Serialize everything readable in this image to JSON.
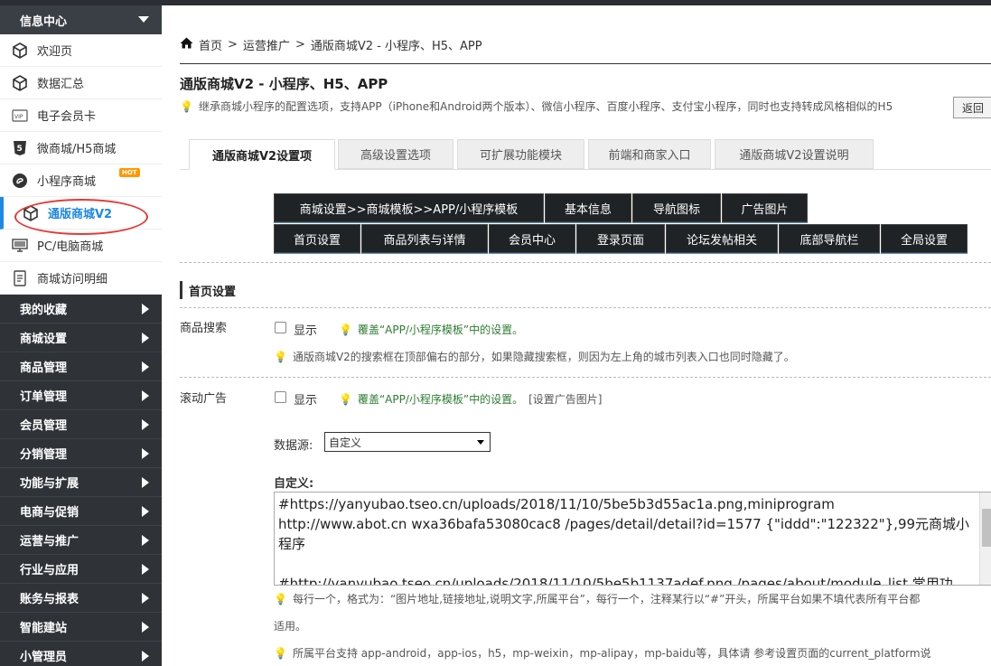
{
  "sidebar": {
    "header": "信息中心",
    "sub_items": [
      {
        "label": "欢迎页",
        "icon": "cube-icon"
      },
      {
        "label": "数据汇总",
        "icon": "cube-icon"
      },
      {
        "label": "电子会员卡",
        "icon": "vip-card-icon"
      },
      {
        "label": "微商城/H5商城",
        "icon": "html5-icon"
      },
      {
        "label": "小程序商城",
        "icon": "mini-program-icon",
        "badge": "HOT"
      },
      {
        "label": "通版商城V2",
        "icon": "cube-icon",
        "active": true
      },
      {
        "label": "PC/电脑商城",
        "icon": "monitor-icon"
      },
      {
        "label": "商城访问明细",
        "icon": "report-icon"
      }
    ],
    "categories": [
      "我的收藏",
      "商城设置",
      "商品管理",
      "订单管理",
      "会员管理",
      "分销管理",
      "功能与扩展",
      "电商与促销",
      "运营与推广",
      "行业与应用",
      "账务与报表",
      "智能建站",
      "小管理员"
    ]
  },
  "breadcrumb": [
    "首页",
    "运营推广",
    "通版商城V2 - 小程序、H5、APP"
  ],
  "page": {
    "title": "通版商城V2 - 小程序、H5、APP",
    "description": "继承商城小程序的配置选项，支持APP（iPhone和Android两个版本）、微信小程序、百度小程序、支付宝小程序，同时也支持转成风格相似的H5",
    "back_label": "返回"
  },
  "tabs": [
    "通版商城V2设置项",
    "高级设置选项",
    "可扩展功能模块",
    "前端和商家入口",
    "通版商城V2设置说明"
  ],
  "button_rows": [
    [
      "商城设置>>商城模板>>APP/小程序模板",
      "基本信息",
      "导航图标",
      "广告图片"
    ],
    [
      "首页设置",
      "商品列表与详情",
      "会员中心",
      "登录页面",
      "论坛发帖相关",
      "底部导航栏",
      "全局设置"
    ]
  ],
  "section": {
    "title": "首页设置",
    "search": {
      "label": "商品搜索",
      "checkbox_label": "显示",
      "note": "覆盖“APP/小程序模板”中的设置。",
      "hint": "通版商城V2的搜索框在顶部偏右的部分，如果隐藏搜索框，则因为左上角的城市列表入口也同时隐藏了。"
    },
    "ads": {
      "label": "滚动广告",
      "checkbox_label": "显示",
      "note": "覆盖“APP/小程序模板”中的设置。",
      "link": "[设置广告图片]",
      "datasource_label": "数据源:",
      "datasource_value": "自定义",
      "custom_label": "自定义:",
      "custom_lines": [
        "#https://yanyubao.tseo.cn/uploads/2018/11/10/5be5b3d55ac1a.png,miniprogram",
        "http://www.abot.cn wxa36bafa53080cac8 /pages/detail/detail?id=1577 {\"iddd\":\"122322\"},99元商城小",
        "程序",
        "",
        "#http://yanyubao.tseo.cn/uploads/2018/11/10/5be5b1137adef.png,/pages/about/module_list,常用功"
      ],
      "hint1a": "每行一个，格式为：“图片地址,链接地址,说明文字,所属平台”，每行一个，注释某行以“#”开头，所属平台如果不填代表所有平台都",
      "hint1b": "适用。",
      "hint2": "所属平台支持 app-android，app-ios，h5，mp-weixin，mp-alipay，mp-baidu等，具体请 参考设置页面的current_platform说"
    }
  }
}
